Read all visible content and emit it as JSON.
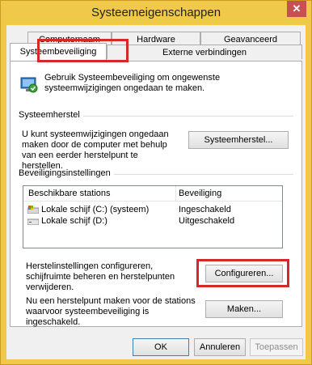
{
  "window": {
    "title": "Systeemeigenschappen",
    "close_glyph": "✕"
  },
  "tabs": {
    "row1": [
      "Computernaam",
      "Hardware",
      "Geavanceerd"
    ],
    "row2": [
      "Systeembeveiliging",
      "Externe verbindingen"
    ]
  },
  "intro": {
    "text": "Gebruik Systeembeveiliging om ongewenste systeemwijzigingen ongedaan te maken."
  },
  "restore": {
    "group_label": "Systeemherstel",
    "text": "U kunt systeemwijzigingen ongedaan maken door de computer met behulp van een eerder herstelpunt te herstellen.",
    "button": "Systeemherstel..."
  },
  "protection": {
    "group_label": "Beveiligingsinstellingen",
    "columns": [
      "Beschikbare stations",
      "Beveiliging"
    ],
    "rows": [
      {
        "drive": "Lokale schijf (C:) (systeem)",
        "status": "Ingeschakeld",
        "icon": "system-drive-icon"
      },
      {
        "drive": "Lokale schijf (D:)",
        "status": "Uitgeschakeld",
        "icon": "local-drive-icon"
      }
    ],
    "configure_text": "Herstelinstellingen configureren, schijfruimte beheren en herstelpunten verwijderen.",
    "configure_button": "Configureren...",
    "create_text": "Nu een herstelpunt maken voor de stations waarvoor systeembeveiliging is ingeschakeld.",
    "create_button": "Maken..."
  },
  "footer": {
    "ok": "OK",
    "cancel": "Annuleren",
    "apply": "Toepassen"
  },
  "colors": {
    "title_bar": "#f0c84a",
    "highlight_box": "#d4282b",
    "close_button": "#c75050"
  }
}
